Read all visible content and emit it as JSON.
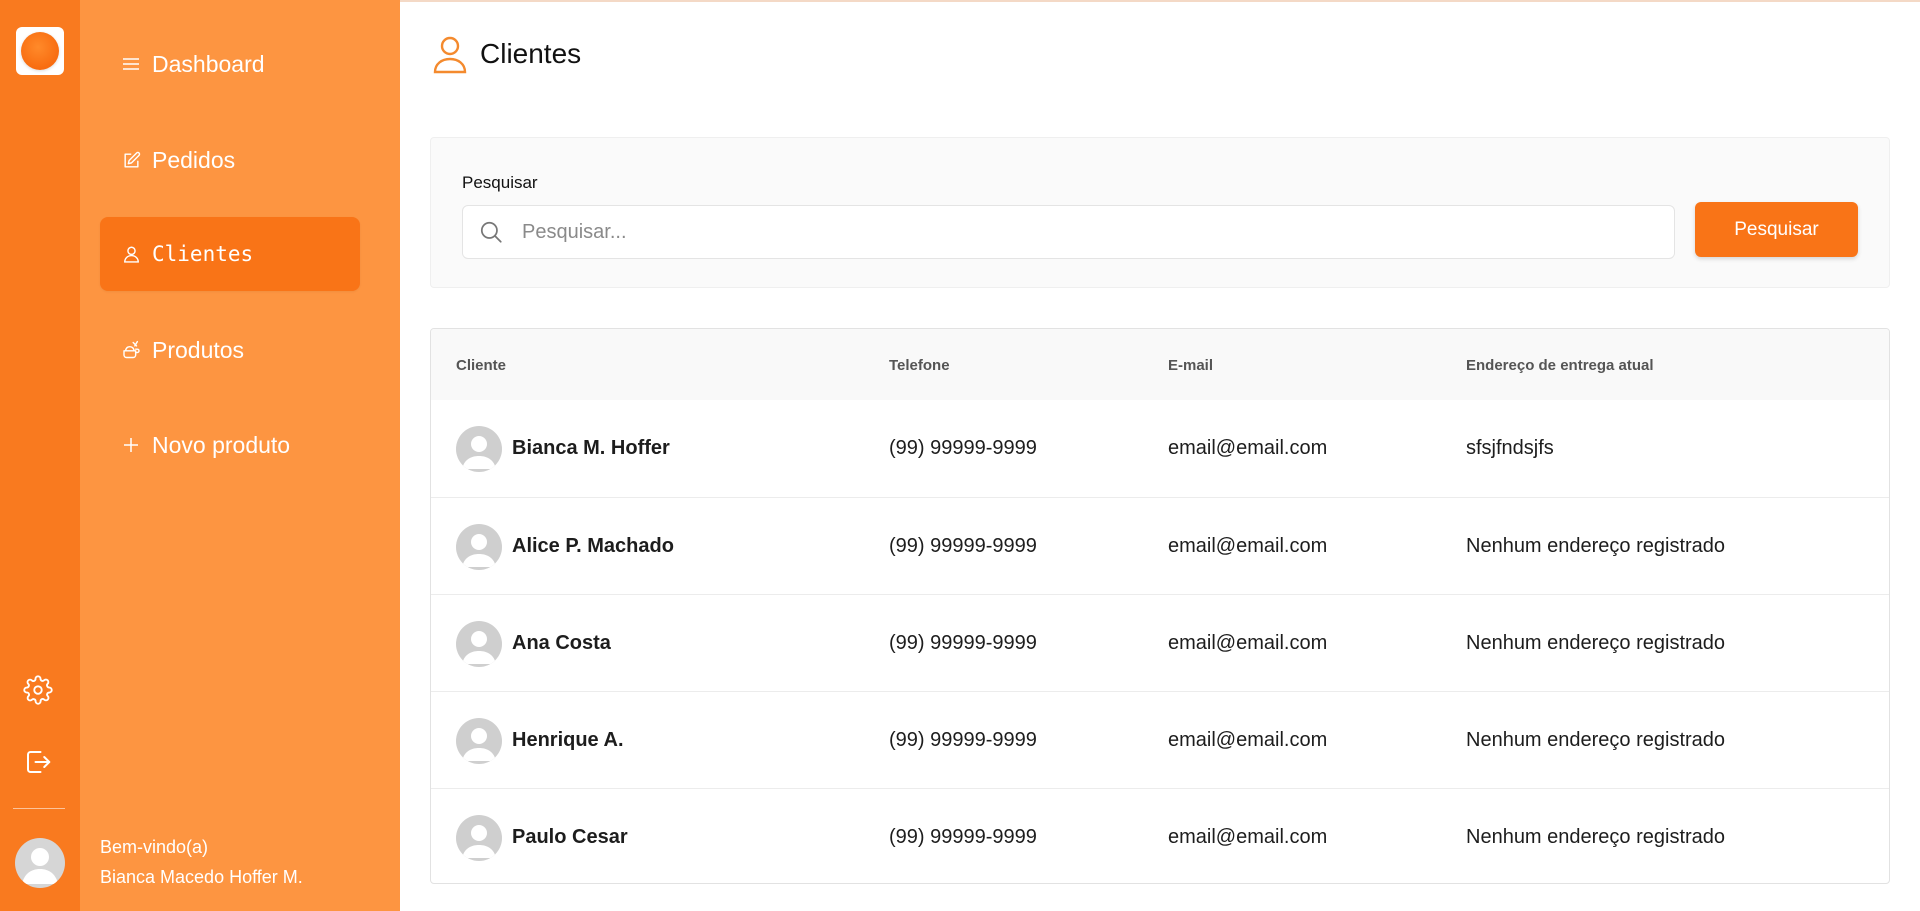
{
  "app": {
    "brand_color": "#f97417",
    "sidebar_color": "#fd9541",
    "rail_color": "#f97a1f"
  },
  "nav": {
    "items": [
      {
        "label": "Dashboard",
        "icon": "menu-lines-icon",
        "active": false
      },
      {
        "label": "Pedidos",
        "icon": "edit-note-icon",
        "active": false
      },
      {
        "label": "Clientes",
        "icon": "user-icon",
        "active": true
      },
      {
        "label": "Produtos",
        "icon": "food-tray-icon",
        "active": false
      },
      {
        "label": "Novo produto",
        "icon": "plus-icon",
        "active": false
      }
    ]
  },
  "user": {
    "greeting": "Bem-vindo(a)",
    "name": "Bianca Macedo Hoffer M."
  },
  "page": {
    "title": "Clientes",
    "title_icon": "user-outline-icon"
  },
  "search": {
    "label": "Pesquisar",
    "placeholder": "Pesquisar...",
    "value": "",
    "button_label": "Pesquisar"
  },
  "table": {
    "columns": [
      "Cliente",
      "Telefone",
      "E-mail",
      "Endereço de entrega atual"
    ],
    "rows": [
      {
        "name": "Bianca M. Hoffer",
        "phone": "(99) 99999-9999",
        "email": "email@email.com",
        "address": "sfsjfndsjfs"
      },
      {
        "name": "Alice P. Machado",
        "phone": "(99) 99999-9999",
        "email": "email@email.com",
        "address": "Nenhum endereço registrado"
      },
      {
        "name": "Ana Costa",
        "phone": "(99) 99999-9999",
        "email": "email@email.com",
        "address": "Nenhum endereço registrado"
      },
      {
        "name": "Henrique A.",
        "phone": "(99) 99999-9999",
        "email": "email@email.com",
        "address": "Nenhum endereço registrado"
      },
      {
        "name": "Paulo Cesar",
        "phone": "(99) 99999-9999",
        "email": "email@email.com",
        "address": "Nenhum endereço registrado"
      }
    ]
  }
}
